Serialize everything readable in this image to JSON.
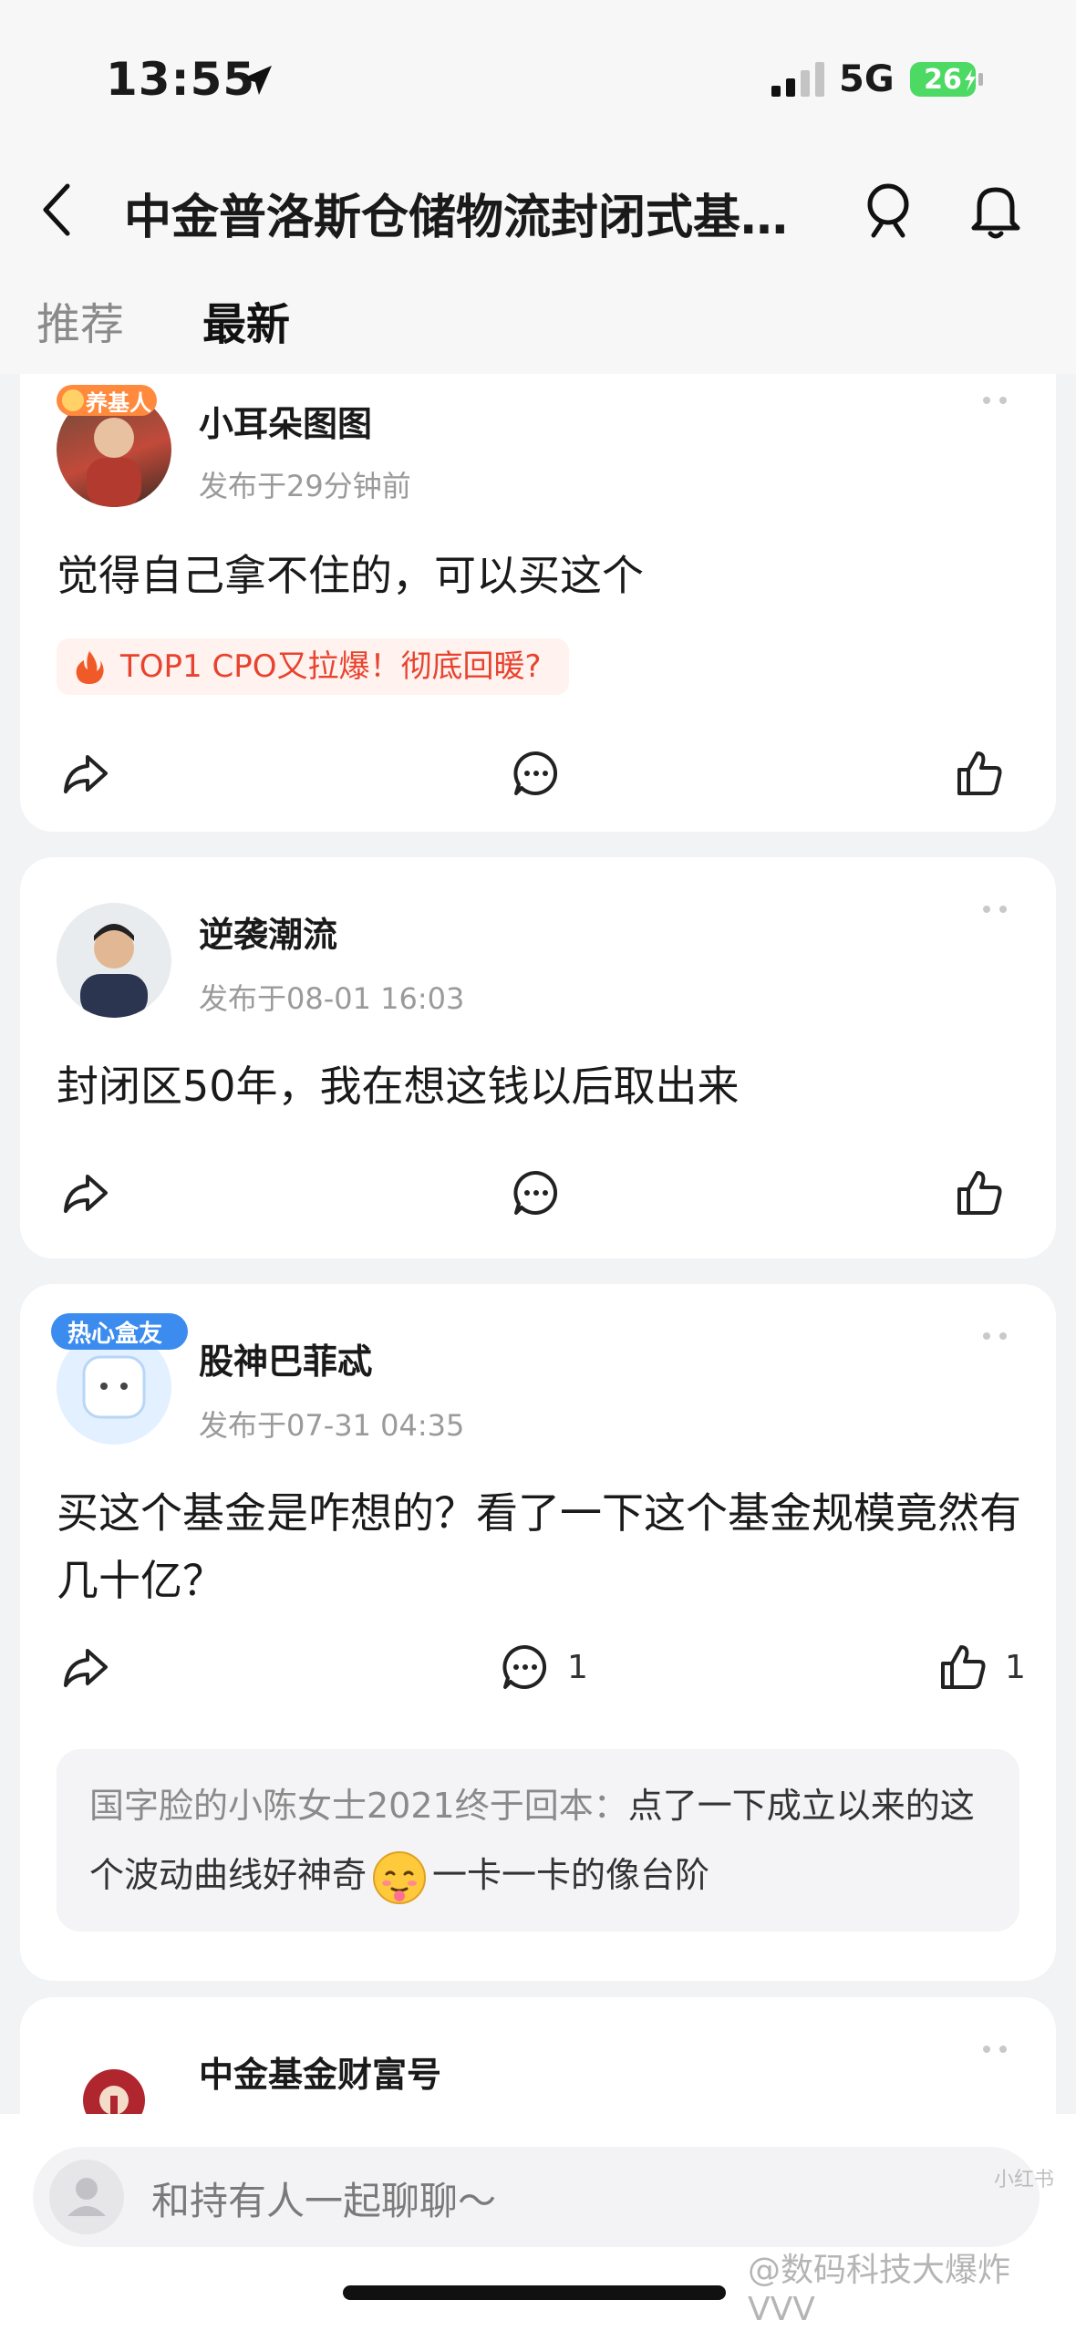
{
  "status": {
    "time": "13:55",
    "network": "5G",
    "battery": "26"
  },
  "header": {
    "title": "中金普洛斯仓储物流封闭式基…"
  },
  "tabs": [
    {
      "label": "推荐"
    },
    {
      "label": "最新"
    }
  ],
  "posts": [
    {
      "user": "小耳朵图图",
      "badge": "养基人",
      "time": "发布于29分钟前",
      "content": "觉得自己拿不住的，可以买这个",
      "hot_topic": "TOP1 CPO又拉爆！彻底回暖?"
    },
    {
      "user": "逆袭潮流",
      "time": "发布于08-01 16:03",
      "content": "封闭区50年，我在想这钱以后取出来"
    },
    {
      "user": "股神巴菲忒",
      "badge": "热心盒友",
      "time": "发布于07-31 04:35",
      "content": "买这个基金是咋想的？看了一下这个基金规模竟然有几十亿？",
      "comments": "1",
      "likes": "1",
      "reply": {
        "name": "国字脸的小陈女士2021终于回本：",
        "text_a": "点了一下成立以来的这个波动曲线好神奇",
        "text_b": "一卡一卡的像台阶"
      }
    },
    {
      "user": "中金基金财富号"
    }
  ],
  "composer": {
    "placeholder": "和持有人一起聊聊～"
  },
  "watermark": "@数码科技大爆炸VVV",
  "watermark_small": "小红书",
  "colors": {
    "accent_red": "#e8432e",
    "hot_bg": "#fff2ef",
    "page_bg": "#f2f3f5"
  }
}
